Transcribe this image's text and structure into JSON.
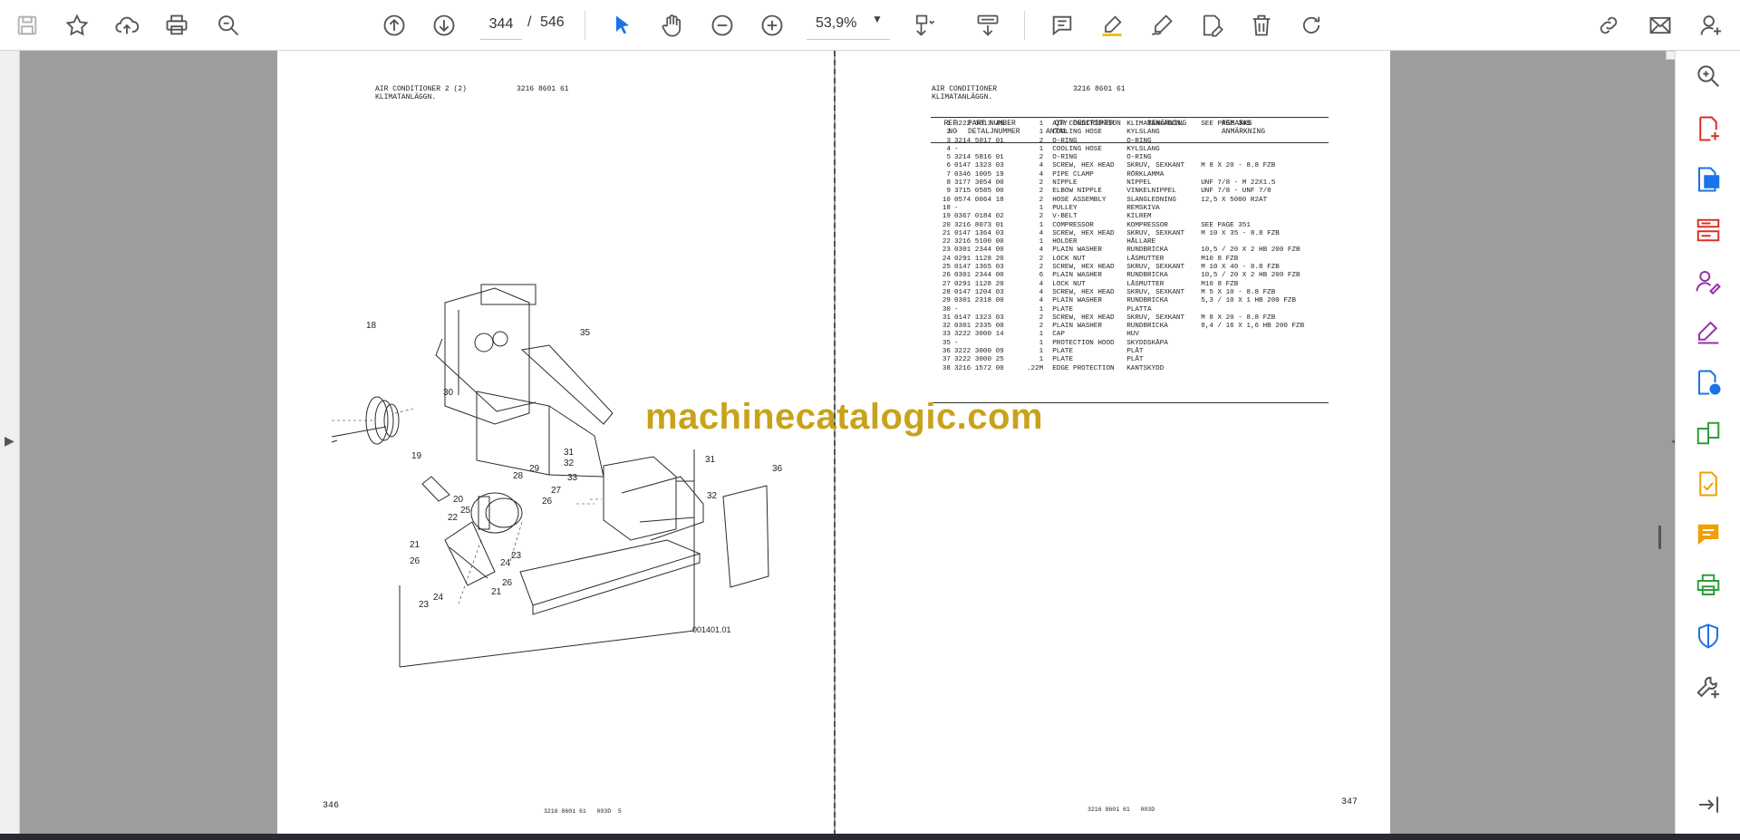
{
  "toolbar": {
    "page_current": "344",
    "page_separator": "/",
    "page_total": "546",
    "zoom": "53,9%"
  },
  "left_page": {
    "title_line1": "AIR CONDITIONER 2 (2)",
    "title_line2": "KLIMATANLÄGGN.",
    "part_no": "3216 8601 61",
    "drawing_id": "001401.01",
    "page_number": "346",
    "footer": "3216 8601 61   003D  5",
    "callouts": [
      "18",
      "35",
      "30",
      "19",
      "31",
      "32",
      "33",
      "29",
      "28",
      "27",
      "26",
      "36",
      "31",
      "32",
      "20",
      "25",
      "22",
      "24",
      "23",
      "21",
      "26",
      "21",
      "26",
      "24",
      "23"
    ]
  },
  "right_page": {
    "title_line1": "AIR CONDITIONER",
    "title_line2": "KLIMATANLÄGGN.",
    "part_no": "3216 8601 61",
    "page_number": "347",
    "footer": "3216 8601 61   003D",
    "columns": {
      "ref": "REF\nNO",
      "part": "PART NUMBER\nDETALJNUMMER",
      "qty": "QTY\nANTAL",
      "desc": "DESCRIPTION",
      "ben": "BENÄMNING",
      "rem": "REMARKS\nANMÄRKNING"
    },
    "rows": [
      [
        "1",
        "3222 3013 46",
        "1",
        "AIR CONDITIONER",
        "KLIMATANLÄGGN.",
        "SEE PAGE 349"
      ],
      [
        "2",
        "-",
        "1",
        "COOLING HOSE",
        "KYLSLANG",
        ""
      ],
      [
        "3",
        "3214 5017 01",
        "2",
        "O-RING",
        "O-RING",
        ""
      ],
      [
        "4",
        "-",
        "1",
        "COOLING HOSE",
        "KYLSLANG",
        ""
      ],
      [
        "5",
        "3214 5816 01",
        "2",
        "O-RING",
        "O-RING",
        ""
      ],
      [
        "6",
        "0147 1323 03",
        "4",
        "SCREW, HEX HEAD",
        "SKRUV, SEXKANT",
        "M 8 X 20 - 8.8 FZB"
      ],
      [
        "7",
        "0346 1005 19",
        "4",
        "PIPE CLAMP",
        "RÖRKLAMMA",
        ""
      ],
      [
        "8",
        "3177 3054 00",
        "2",
        "NIPPLE",
        "NIPPEL",
        "UNF 7/8 - M 22X1.5"
      ],
      [
        "9",
        "3715 0585 00",
        "2",
        "ELBOW NIPPLE",
        "VINKELNIPPEL",
        "UNF 7/8 - UNF 7/8"
      ],
      [
        "10",
        "0574 0064 18",
        "2",
        "HOSE ASSEMBLY",
        "SLANGLEDNING",
        "12,5 X 5000  R2AT"
      ],
      [
        "18",
        "-",
        "1",
        "PULLEY",
        "REMSKIVA",
        ""
      ],
      [
        "19",
        "0367 0184 02",
        "2",
        "V-BELT",
        "KILREM",
        ""
      ],
      [
        "20",
        "3216 8073 01",
        "1",
        "COMPRESSOR",
        "KOMPRESSOR",
        "SEE PAGE 351"
      ],
      [
        "21",
        "0147 1364 03",
        "4",
        "SCREW, HEX HEAD",
        "SKRUV, SEXKANT",
        "M 10 X 35 - 8.8 FZB"
      ],
      [
        "22",
        "3216 5100 00",
        "1",
        "HOLDER",
        "HÅLLARE",
        ""
      ],
      [
        "23",
        "0301 2344 00",
        "4",
        "PLAIN WASHER",
        "RUNDBRICKA",
        "10,5 / 20 X 2 HB 200 FZB"
      ],
      [
        "24",
        "0291 1128 20",
        "2",
        "LOCK NUT",
        "LÅSMUTTER",
        "M10   8 FZB"
      ],
      [
        "25",
        "0147 1365 03",
        "2",
        "SCREW, HEX HEAD",
        "SKRUV, SEXKANT",
        "M 10 X 40 - 8.8 FZB"
      ],
      [
        "26",
        "0301 2344 00",
        "6",
        "PLAIN WASHER",
        "RUNDBRICKA",
        "10,5 / 20 X 2 HB 200 FZB"
      ],
      [
        "27",
        "0291 1128 20",
        "4",
        "LOCK NUT",
        "LÅSMUTTER",
        "M10   8 FZB"
      ],
      [
        "28",
        "0147 1204 03",
        "4",
        "SCREW, HEX HEAD",
        "SKRUV, SEXKANT",
        "M 5 X 10 - 8.8 FZB"
      ],
      [
        "29",
        "0301 2318 00",
        "4",
        "PLAIN WASHER",
        "RUNDBRICKA",
        "5,3 / 10 X 1 HB 200 FZB"
      ],
      [
        "30",
        "-",
        "1",
        "PLATE",
        "PLATTA",
        ""
      ],
      [
        "31",
        "0147 1323 03",
        "2",
        "SCREW, HEX HEAD",
        "SKRUV, SEXKANT",
        "M 8 X 20 - 8.8 FZB"
      ],
      [
        "32",
        "0301 2335 00",
        "2",
        "PLAIN WASHER",
        "RUNDBRICKA",
        "8,4 / 16 X 1,6 HB 200 FZB"
      ],
      [
        "33",
        "3222 3000 14",
        "1",
        "CAP",
        "HUV",
        ""
      ],
      [
        "35",
        "-",
        "1",
        "PROTECTION HOOD",
        "SKYDDSKÅPA",
        ""
      ],
      [
        "36",
        "3222 3000 09",
        "1",
        "PLATE",
        "PLÅT",
        ""
      ],
      [
        "37",
        "3222 3000 25",
        "1",
        "PLATE",
        "PLÅT",
        ""
      ],
      [
        "38",
        "3216 1572 00",
        ".22M",
        "EDGE PROTECTION",
        "KANTSKYDD",
        ""
      ]
    ]
  },
  "watermark": "machinecatalogic.com",
  "colors": {
    "accent": "#1a73e8",
    "watermark": "#c9a21b",
    "panel_icons": [
      "#d93025",
      "#1a73e8",
      "#d93025",
      "#9b2fae",
      "#9b2fae",
      "#1a73e8",
      "#2e9d3c",
      "#f0a000",
      "#f0a000",
      "#2e9d3c",
      "#1a73e8",
      "#555555"
    ]
  }
}
